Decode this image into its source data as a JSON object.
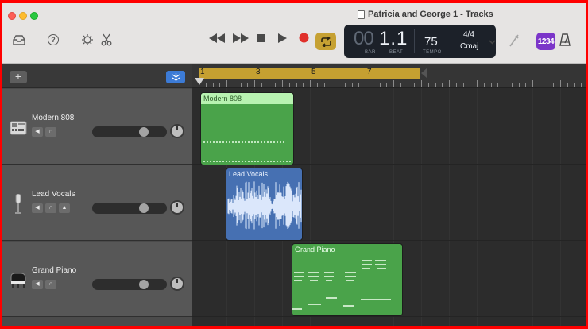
{
  "window": {
    "title": "Patricia and George  1 - Tracks"
  },
  "lcd": {
    "bar": "00",
    "beat": "1.1",
    "bar_label": "BAR",
    "beat_label": "BEAT",
    "tempo": "75",
    "tempo_label": "TEMPO",
    "time_signature": "4/4",
    "key": "Cmaj"
  },
  "count_in": "1234",
  "tracks": [
    {
      "name": "Modern 808",
      "icon": "drum-machine-icon",
      "volume_fraction": 0.72
    },
    {
      "name": "Lead Vocals",
      "icon": "microphone-icon",
      "volume_fraction": 0.72
    },
    {
      "name": "Grand Piano",
      "icon": "grand-piano-icon",
      "volume_fraction": 0.72
    }
  ],
  "ruler": {
    "bars": [
      "1",
      "3",
      "5",
      "7"
    ]
  },
  "regions": [
    {
      "name": "Modern 808",
      "color": "#4aa34a"
    },
    {
      "name": "Lead Vocals",
      "color": "#4670b2"
    },
    {
      "name": "Grand Piano",
      "color": "#4aa34a"
    }
  ],
  "colors": {
    "cycle_accent": "#c6a133",
    "record": "#e0302b",
    "count_in": "#7b35c9",
    "filter": "#3c7bd6"
  }
}
